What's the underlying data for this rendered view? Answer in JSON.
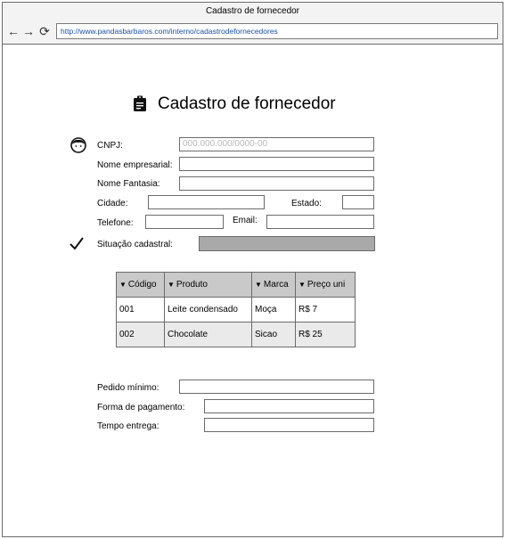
{
  "window": {
    "title": "Cadastro de fornecedor"
  },
  "browser": {
    "url": "http://www.pandasbarbaros.com/interno/cadastrodefornecedores"
  },
  "page": {
    "title": "Cadastro de fornecedor"
  },
  "form": {
    "cnpj_label": "CNPJ:",
    "cnpj_placeholder": "000.000.000/0000-00",
    "nome_empresarial_label": "Nome empresarial:",
    "nome_fantasia_label": "Nome Fantasia:",
    "cidade_label": "Cidade:",
    "estado_label": "Estado:",
    "telefone_label": "Telefone:",
    "email_label": "Email:",
    "situacao_label": "Situação cadastral:"
  },
  "table": {
    "headers": [
      "Código",
      "Produto",
      "Marca",
      "Preço uni"
    ],
    "rows": [
      [
        "001",
        "Leite condensado",
        "Moça",
        "R$ 7"
      ],
      [
        "002",
        "Chocolate",
        "Sicao",
        "R$ 25"
      ]
    ]
  },
  "order": {
    "pedido_minimo_label": "Pedido mínimo:",
    "forma_pagamento_label": "Forma de pagamento:",
    "tempo_entrega_label": "Tempo entrega:"
  }
}
